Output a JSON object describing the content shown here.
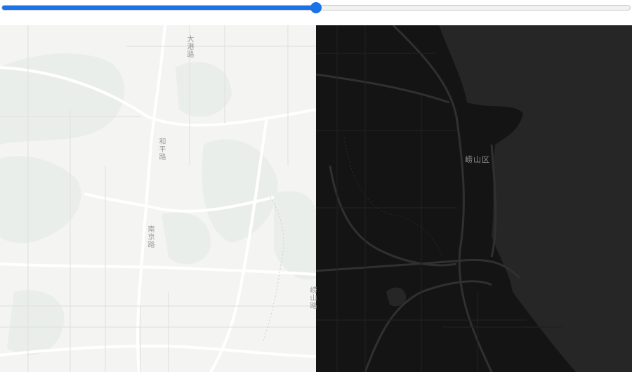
{
  "compare_slider": {
    "value": 0.5
  },
  "map": {
    "left_style": "light",
    "right_style": "dark",
    "colors": {
      "light_bg": "#f4f4f2",
      "light_green": "#eaeeea",
      "light_road": "#ffffff",
      "dark_bg": "#141414",
      "dark_sea": "#262626",
      "dark_road": "#333333"
    },
    "labels": {
      "road_1": "大港路",
      "road_2": "和平路",
      "road_3": "南京路",
      "road_4": "崂山路",
      "district": "崂山区"
    }
  }
}
